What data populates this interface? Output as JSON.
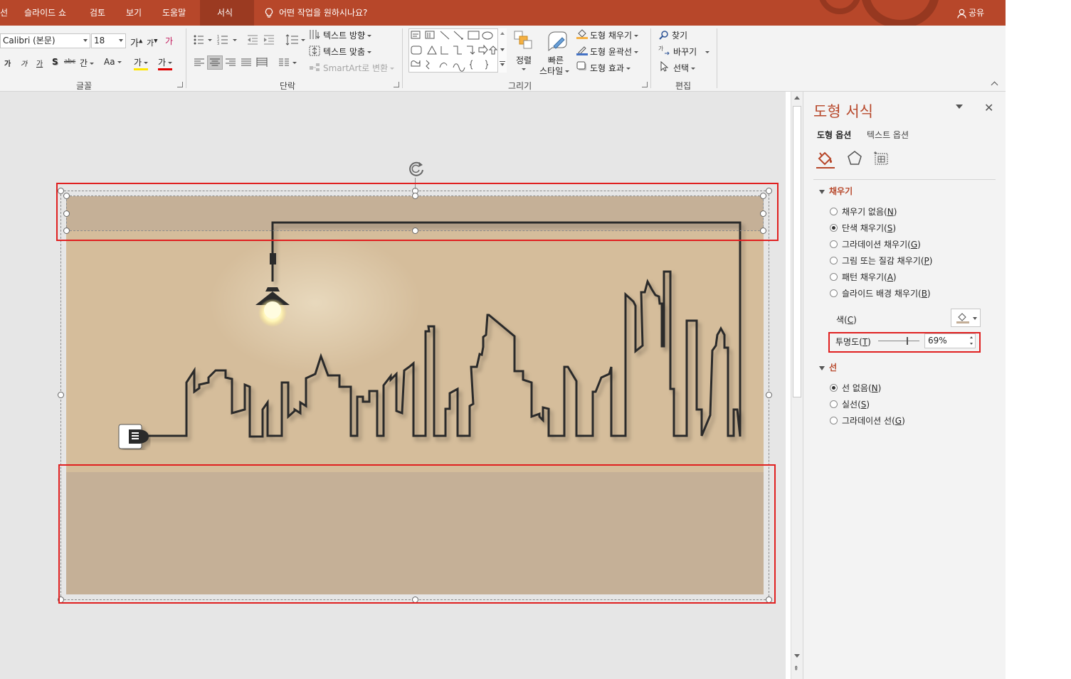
{
  "tabs": [
    {
      "label": "선",
      "active": false
    },
    {
      "label": "슬라이드 쇼",
      "active": false
    },
    {
      "label": "검토",
      "active": false
    },
    {
      "label": "보기",
      "active": false
    },
    {
      "label": "도움말",
      "active": false
    },
    {
      "label": "서식",
      "active": true
    }
  ],
  "tell_me": "어떤 작업을 원하시나요?",
  "share": "공유",
  "ribbon": {
    "font": {
      "family": "Calibri (본문)",
      "size": "18",
      "grow": "가",
      "shrink": "가",
      "clear": "가",
      "bold": "가",
      "italic": "가",
      "underline": "가",
      "shadow": "S",
      "strike": "abc",
      "spacing": "간",
      "case": "Aa",
      "highlight": "가",
      "color": "가",
      "group_label": "글꼴"
    },
    "paragraph": {
      "text_direction": "텍스트 방향",
      "align_text": "텍스트 맞춤",
      "smartart": "SmartArt로 변환",
      "group_label": "단락"
    },
    "drawing": {
      "arrange": "정렬",
      "quick_styles_line1": "빠른",
      "quick_styles_line2": "스타일",
      "shape_fill": "도형 채우기",
      "shape_outline": "도형 윤곽선",
      "shape_effects": "도형 효과",
      "group_label": "그리기"
    },
    "editing": {
      "find": "찾기",
      "replace": "바꾸기",
      "select": "선택",
      "group_label": "편집"
    }
  },
  "pane": {
    "title": "도형 서식",
    "tab_shape": "도형 옵션",
    "tab_text": "텍스트 옵션",
    "fill_section": "채우기",
    "fill_options": [
      {
        "label": "채우기 없음",
        "key": "N",
        "selected": false
      },
      {
        "label": "단색 채우기",
        "key": "S",
        "selected": true
      },
      {
        "label": "그라데이션 채우기",
        "key": "G",
        "selected": false
      },
      {
        "label": "그림 또는 질감 채우기",
        "key": "P",
        "selected": false
      },
      {
        "label": "패턴 채우기",
        "key": "A",
        "selected": false
      },
      {
        "label": "슬라이드 배경 채우기",
        "key": "B",
        "selected": false
      }
    ],
    "color_label": "색",
    "color_key": "C",
    "transparency_label": "투명도",
    "transparency_key": "T",
    "transparency_value": "69%",
    "transparency_fraction": 0.69,
    "line_section": "선",
    "line_options": [
      {
        "label": "선 없음",
        "key": "N",
        "selected": true
      },
      {
        "label": "실선",
        "key": "S",
        "selected": false
      },
      {
        "label": "그라데이션 선",
        "key": "G",
        "selected": false
      }
    ]
  },
  "colors": {
    "accent": "#b7472a",
    "slide_bg": "#d5bd9b",
    "band_fill": "#c3ae97",
    "highlight_box": "#e02020"
  }
}
